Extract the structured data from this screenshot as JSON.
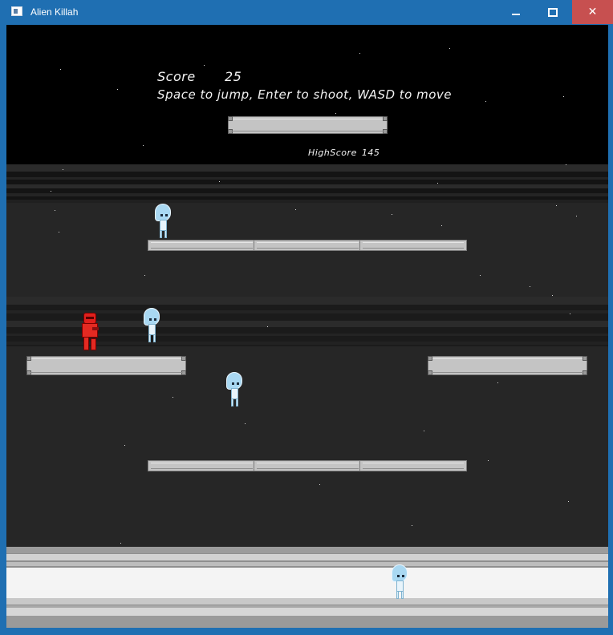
{
  "window": {
    "title": "Alien Killah",
    "controls": {
      "minimize": "minimize-icon",
      "maximize": "maximize-icon",
      "close": "✕"
    }
  },
  "hud": {
    "score_label": "Score",
    "score_value": "25",
    "instructions": "Space to jump, Enter to shoot, WASD to move",
    "highscore_label": "HighScore",
    "highscore_value": "145"
  },
  "colors": {
    "titlebar": "#1f6fb2",
    "close_button": "#c75050",
    "player": "#e32a22",
    "alien": "#a9d8f2",
    "platform": "#c4c4c4"
  }
}
